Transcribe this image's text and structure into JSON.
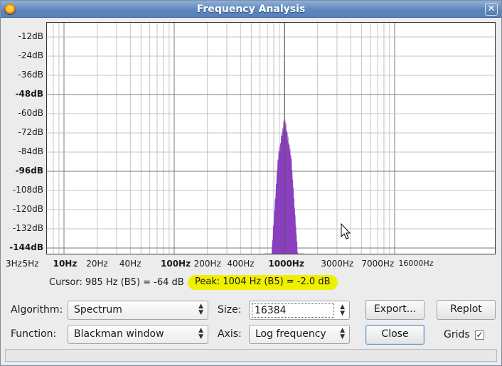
{
  "window": {
    "title": "Frequency Analysis"
  },
  "plot": {
    "y_labels": [
      {
        "text": "-12dB",
        "bold": false
      },
      {
        "text": "-24dB",
        "bold": false
      },
      {
        "text": "-36dB",
        "bold": false
      },
      {
        "text": "-48dB",
        "bold": true
      },
      {
        "text": "-60dB",
        "bold": false
      },
      {
        "text": "-72dB",
        "bold": false
      },
      {
        "text": "-84dB",
        "bold": false
      },
      {
        "text": "-96dB",
        "bold": true
      },
      {
        "text": "-108dB",
        "bold": false
      },
      {
        "text": "-120dB",
        "bold": false
      },
      {
        "text": "-132dB",
        "bold": false
      },
      {
        "text": "-144dB",
        "bold": true
      }
    ],
    "x_labels": [
      "3Hz",
      "5Hz",
      "10Hz",
      "20Hz",
      "40Hz",
      "100Hz",
      "200Hz",
      "400Hz",
      "1000Hz",
      "3000Hz",
      "7000Hz",
      "16000Hz"
    ],
    "spectrum_color": "#8a3fbf"
  },
  "readout": {
    "cursor": "Cursor: 985 Hz (B5) = -64 dB",
    "peak": "Peak: 1004 Hz (B5) = -2.0 dB"
  },
  "controls": {
    "algorithm_label": "Algorithm:",
    "algorithm_value": "Spectrum",
    "function_label": "Function:",
    "function_value": "Blackman window",
    "size_label": "Size:",
    "size_value": "16384",
    "axis_label": "Axis:",
    "axis_value": "Log frequency",
    "export_label": "Export...",
    "replot_label": "Replot",
    "close_label": "Close",
    "grids_label": "Grids",
    "grids_checked": "✓"
  }
}
